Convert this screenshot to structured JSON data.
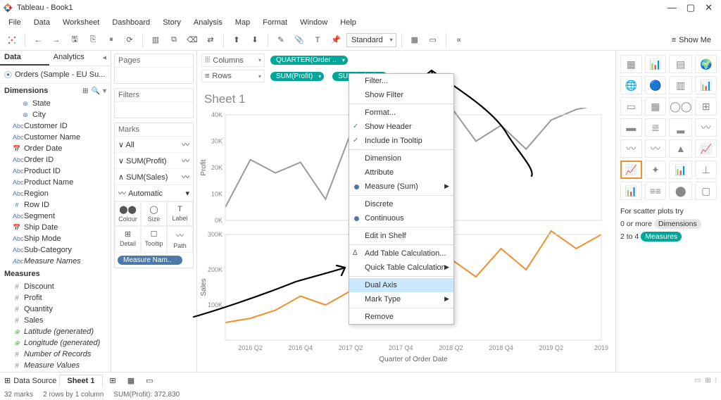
{
  "title": "Tableau - Book1",
  "window_buttons": {
    "min": "—",
    "max": "▢",
    "close": "✕"
  },
  "menus": [
    "File",
    "Data",
    "Worksheet",
    "Dashboard",
    "Story",
    "Analysis",
    "Map",
    "Format",
    "Window",
    "Help"
  ],
  "dropdown_fit": "Standard",
  "showme_label": "Show Me",
  "data_pane": {
    "tabs": [
      "Data",
      "Analytics"
    ],
    "source": "Orders (Sample - EU Su...",
    "sections": {
      "dimensions": {
        "label": "Dimensions",
        "items": [
          {
            "glyph": "⊕",
            "text": "State",
            "indent": true
          },
          {
            "glyph": "⊕",
            "text": "City",
            "indent": true
          },
          {
            "glyph": "Abc",
            "text": "Customer ID"
          },
          {
            "glyph": "Abc",
            "text": "Customer Name"
          },
          {
            "glyph": "📅",
            "text": "Order Date"
          },
          {
            "glyph": "Abc",
            "text": "Order ID"
          },
          {
            "glyph": "Abc",
            "text": "Product ID"
          },
          {
            "glyph": "Abc",
            "text": "Product Name"
          },
          {
            "glyph": "Abc",
            "text": "Region"
          },
          {
            "glyph": "#",
            "text": "Row ID"
          },
          {
            "glyph": "Abc",
            "text": "Segment"
          },
          {
            "glyph": "📅",
            "text": "Ship Date"
          },
          {
            "glyph": "Abc",
            "text": "Ship Mode"
          },
          {
            "glyph": "Abc",
            "text": "Sub-Category"
          },
          {
            "glyph": "Abc",
            "text": "Measure Names",
            "italic": true
          }
        ]
      },
      "measures": {
        "label": "Measures",
        "items": [
          {
            "glyph": "#",
            "text": "Discount"
          },
          {
            "glyph": "#",
            "text": "Profit"
          },
          {
            "glyph": "#",
            "text": "Quantity"
          },
          {
            "glyph": "#",
            "text": "Sales"
          },
          {
            "glyph": "⊕",
            "text": "Latitude (generated)",
            "italic": true
          },
          {
            "glyph": "⊕",
            "text": "Longitude (generated)",
            "italic": true
          },
          {
            "glyph": "#",
            "text": "Number of Records",
            "italic": true
          },
          {
            "glyph": "#",
            "text": "Measure Values",
            "italic": true
          }
        ]
      }
    }
  },
  "cards": {
    "pages": "Pages",
    "filters": "Filters",
    "marks": {
      "label": "Marks",
      "rows": [
        {
          "text": "All",
          "expand": "∨"
        },
        {
          "text": "SUM(Profit)",
          "expand": "∨"
        },
        {
          "text": "SUM(Sales)",
          "expand": "∧"
        }
      ],
      "marktype": "Automatic",
      "cells": [
        {
          "ic": "⬤⬤",
          "lbl": "Colour"
        },
        {
          "ic": "◯",
          "lbl": "Size"
        },
        {
          "ic": "T",
          "lbl": "Label"
        },
        {
          "ic": "⊞",
          "lbl": "Detail"
        },
        {
          "ic": "☐",
          "lbl": "Tooltip"
        },
        {
          "ic": "〰",
          "lbl": "Path"
        }
      ],
      "pill": "Measure Nam.."
    }
  },
  "shelves": {
    "columns": {
      "label": "Columns",
      "pills": [
        "QUARTER(Order .."
      ]
    },
    "rows": {
      "label": "Rows",
      "pills": [
        "SUM(Profit)",
        "SUM(Sales)"
      ]
    }
  },
  "sheet_title": "Sheet 1",
  "chart_data": {
    "type": "line",
    "x": [
      "2016 Q2",
      "2016 Q4",
      "2017 Q2",
      "2017 Q4",
      "2018 Q2",
      "2018 Q4",
      "2019 Q2",
      "2019"
    ],
    "series": [
      {
        "name": "Profit",
        "color": "#9a9a9a",
        "ylabel": "Profit",
        "ylim": [
          0,
          40000
        ],
        "yticks": [
          "0K",
          "10K",
          "20K",
          "30K",
          "40K"
        ],
        "values": [
          5000,
          23000,
          18000,
          22000,
          8000,
          33000,
          29000,
          43000,
          35000,
          43000,
          30000,
          36000,
          27000,
          38000,
          42000,
          44000
        ]
      },
      {
        "name": "Sales",
        "color": "#f28e2b",
        "ylabel": "Sales",
        "ylim": [
          0,
          300000
        ],
        "yticks": [
          "100K",
          "200K",
          "300K"
        ],
        "values": [
          50000,
          62000,
          85000,
          125000,
          100000,
          140000,
          130000,
          180000,
          150000,
          230000,
          180000,
          260000,
          200000,
          310000,
          260000,
          300000
        ]
      }
    ],
    "xlabel": "Quarter of Order Date"
  },
  "context_menu": {
    "items": [
      {
        "t": "Filter..."
      },
      {
        "t": "Show Filter"
      },
      {
        "sep": true
      },
      {
        "t": "Format..."
      },
      {
        "t": "Show Header",
        "chk": true
      },
      {
        "t": "Include in Tooltip",
        "chk": true
      },
      {
        "sep": true
      },
      {
        "t": "Dimension"
      },
      {
        "t": "Attribute"
      },
      {
        "t": "Measure (Sum)",
        "dot": true,
        "sub": true
      },
      {
        "sep": true
      },
      {
        "t": "Discrete"
      },
      {
        "t": "Continuous",
        "dot": true
      },
      {
        "sep": true
      },
      {
        "t": "Edit in Shelf"
      },
      {
        "sep": true
      },
      {
        "t": "Add Table Calculation...",
        "pre": "Δ"
      },
      {
        "t": "Quick Table Calculation",
        "sub": true
      },
      {
        "sep": true
      },
      {
        "t": "Dual Axis",
        "hl": true
      },
      {
        "t": "Mark Type",
        "sub": true
      },
      {
        "sep": true
      },
      {
        "t": "Remove"
      }
    ]
  },
  "showme_panel": {
    "try_text": "For scatter plots try",
    "line1_a": "0 or more",
    "line1_b": "Dimensions",
    "line2_a": "2 to 4",
    "line2_b": "Measures"
  },
  "bottom": {
    "datasource": "Data Source",
    "sheet": "Sheet 1"
  },
  "status": {
    "marks": "32 marks",
    "layout": "2 rows by 1 column",
    "sum": "SUM(Profit): 372,830"
  }
}
